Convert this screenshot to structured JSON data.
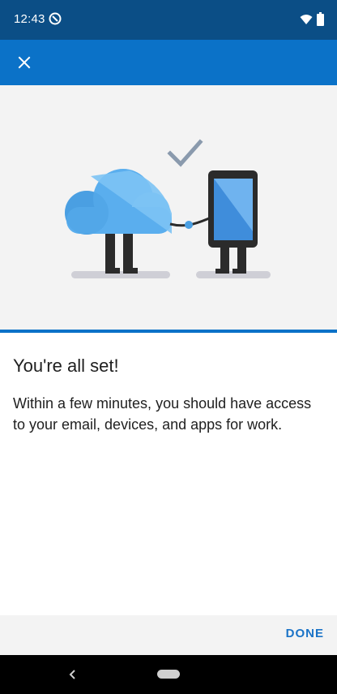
{
  "status_bar": {
    "time": "12:43",
    "app_icon": "circle-app-icon",
    "wifi_icon": "wifi-icon",
    "battery_icon": "battery-icon"
  },
  "app_bar": {
    "close_icon": "close-icon",
    "color": "#0b72c8"
  },
  "hero": {
    "illustration": "cloud-and-phone-handshake-illustration",
    "check_icon": "checkmark-icon"
  },
  "content": {
    "title": "You're all set!",
    "body": "Within a few minutes, you should have access to your email, devices, and apps for work."
  },
  "footer": {
    "done_label": "DONE"
  },
  "nav_bar": {
    "back_icon": "back-icon",
    "home_icon": "home-pill-icon"
  },
  "colors": {
    "status_bar": "#0b4e86",
    "accent": "#0b72c8",
    "done_text": "#1a73c7"
  }
}
